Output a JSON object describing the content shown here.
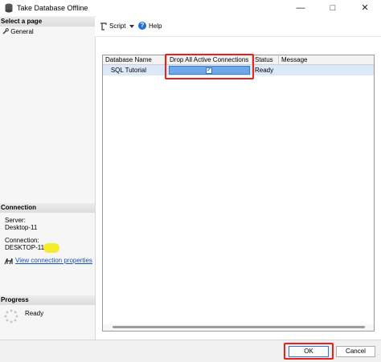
{
  "window": {
    "title": "Take Database Offline",
    "minimize_glyph": "—",
    "maximize_glyph": "□",
    "close_glyph": "✕"
  },
  "left_panel": {
    "select_page_header": "Select a page",
    "pages": [
      {
        "label": "General",
        "icon": "wrench-icon"
      }
    ],
    "connection_header": "Connection",
    "server_label": "Server:",
    "server_value": "Desktop-11",
    "connection_label": "Connection:",
    "connection_value": "DESKTOP-11",
    "view_connection_link": "View connection properties",
    "progress_header": "Progress",
    "progress_status": "Ready"
  },
  "toolbar": {
    "script_label": "Script",
    "help_label": "Help",
    "help_glyph": "?"
  },
  "grid": {
    "columns": [
      "Database Name",
      "Drop All Active Connections",
      "Status",
      "Message"
    ],
    "rows": [
      {
        "database_name": "SQL Tutorial",
        "drop_all_active_connections": true,
        "status": "Ready",
        "message": ""
      }
    ],
    "check_glyph": "✓"
  },
  "buttons": {
    "ok": "OK",
    "cancel": "Cancel"
  },
  "colors": {
    "selection": "#dbe8f7",
    "checkbox_cell": "#6ea8e8",
    "annotation_red": "#e8211a",
    "link": "#1a4fb4",
    "highlight_yellow": "#f5ea1a"
  }
}
